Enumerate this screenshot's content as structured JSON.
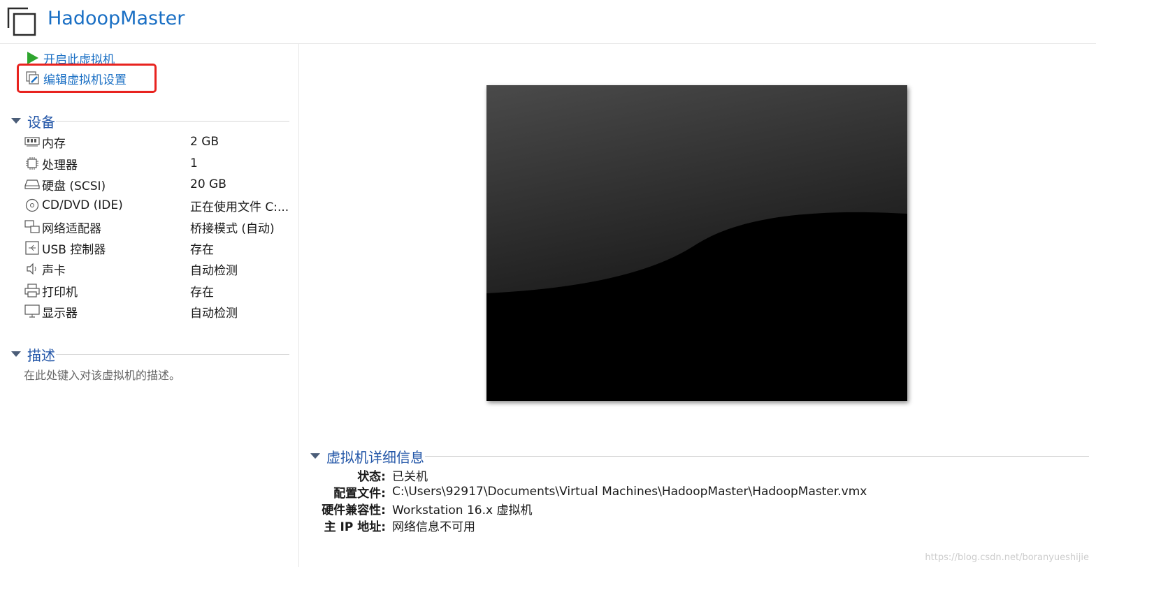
{
  "header": {
    "title": "HadoopMaster",
    "icon": "vm-window-icon"
  },
  "commands": {
    "start": "开启此虚拟机",
    "edit": "编辑虚拟机设置"
  },
  "devices": {
    "title": "设备",
    "items": [
      {
        "name": "内存",
        "value": "2 GB",
        "icon": "memory-icon"
      },
      {
        "name": "处理器",
        "value": "1",
        "icon": "processor-icon"
      },
      {
        "name": "硬盘 (SCSI)",
        "value": "20 GB",
        "icon": "harddisk-icon"
      },
      {
        "name": "CD/DVD (IDE)",
        "value": "正在使用文件 C:...",
        "icon": "cd-dvd-icon"
      },
      {
        "name": "网络适配器",
        "value": "桥接模式 (自动)",
        "icon": "network-adapter-icon"
      },
      {
        "name": "USB 控制器",
        "value": "存在",
        "icon": "usb-icon"
      },
      {
        "name": "声卡",
        "value": "自动检测",
        "icon": "speaker-icon"
      },
      {
        "name": "打印机",
        "value": "存在",
        "icon": "printer-icon"
      },
      {
        "name": "显示器",
        "value": "自动检测",
        "icon": "monitor-icon"
      }
    ]
  },
  "description": {
    "title": "描述",
    "placeholder": "在此处键入对该虚拟机的描述。"
  },
  "details": {
    "title": "虚拟机详细信息",
    "rows": [
      {
        "label": "状态:",
        "value": "已关机"
      },
      {
        "label": "配置文件:",
        "value": "C:\\Users\\92917\\Documents\\Virtual Machines\\HadoopMaster\\HadoopMaster.vmx"
      },
      {
        "label": "硬件兼容性:",
        "value": "Workstation 16.x 虚拟机"
      },
      {
        "label": "主 IP 地址:",
        "value": "网络信息不可用"
      }
    ]
  },
  "watermark": "https://blog.csdn.net/boranyueshijie",
  "colors": {
    "accent": "#1a6fc4",
    "highlight": "#e8231f",
    "section": "#2457a8"
  }
}
